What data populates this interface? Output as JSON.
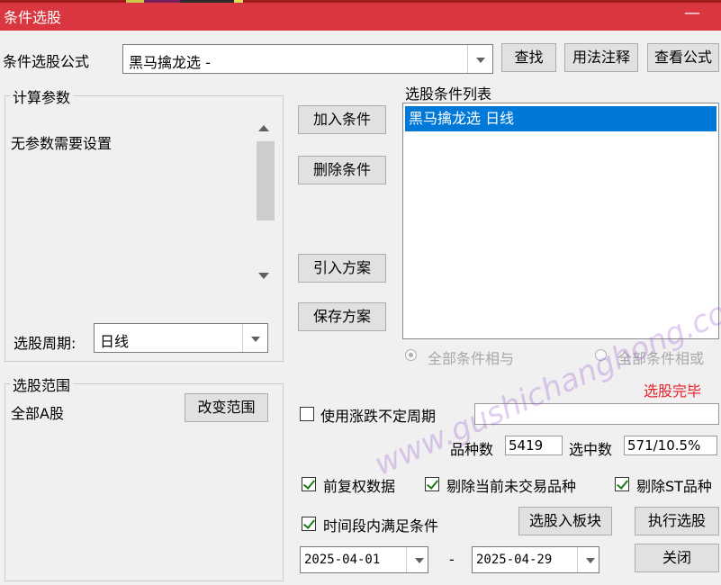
{
  "window": {
    "title": "条件选股",
    "minimize": "—"
  },
  "formula": {
    "label": "条件选股公式",
    "value": "黑马擒龙选  -",
    "find": "查找",
    "usage": "用法注释",
    "view": "查看公式"
  },
  "params": {
    "group_label": "计算参数",
    "text": "无参数需要设置",
    "period_label": "选股周期:",
    "period_value": "日线"
  },
  "buttons": {
    "add": "加入条件",
    "delete": "删除条件",
    "import": "引入方案",
    "save": "保存方案"
  },
  "conditions": {
    "group_label": "选股条件列表",
    "items": [
      "黑马擒龙选  日线"
    ]
  },
  "logic": {
    "and_label": "全部条件相与",
    "or_label": "全部条件相或"
  },
  "status": {
    "text": "选股完毕",
    "color": "#e8202a"
  },
  "scope": {
    "group_label": "选股范围",
    "value": "全部A股",
    "change": "改变范围"
  },
  "options": {
    "irregular_period": "使用涨跌不定周期",
    "irregular_period_value": "",
    "count_label": "品种数",
    "count_value": "5419",
    "selected_label": "选中数",
    "selected_value": "571/10.5%",
    "pre_adjust": "前复权数据",
    "exclude_untraded": "剔除当前未交易品种",
    "exclude_st": "剔除ST品种",
    "time_range": "时间段内满足条件"
  },
  "actions": {
    "to_block": "选股入板块",
    "execute": "执行选股",
    "close": "关闭"
  },
  "dates": {
    "start": "2025-04-01",
    "sep": "-",
    "end": "2025-04-29"
  },
  "watermark": "www.gushichanghong.com"
}
